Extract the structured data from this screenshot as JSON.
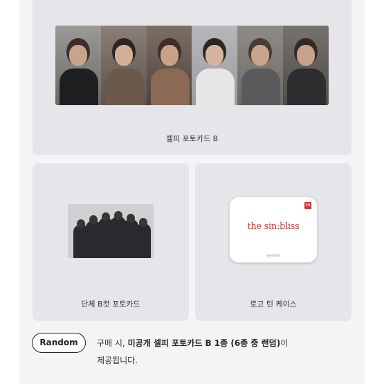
{
  "cards": {
    "top": {
      "caption": "셀피 포토카드 B",
      "photo_count": 6
    },
    "left": {
      "caption": "단체 B컷 포토카드"
    },
    "right": {
      "caption": "로고 틴 케이스",
      "tin_logo": "the sin:bliss",
      "tin_badge": "EN",
      "tin_small": "ENHYPEN"
    }
  },
  "random": {
    "badge_label": "Random",
    "note_prefix": "구매 시, ",
    "note_bold": "미공개 셀피 포토카드 B 1종 (6종 중 랜덤)",
    "note_suffix_line1": "이",
    "note_line2": "제공됩니다."
  },
  "colors": {
    "card_bg": "#e6e6ea",
    "tin_logo_red": "#c93a2f"
  }
}
